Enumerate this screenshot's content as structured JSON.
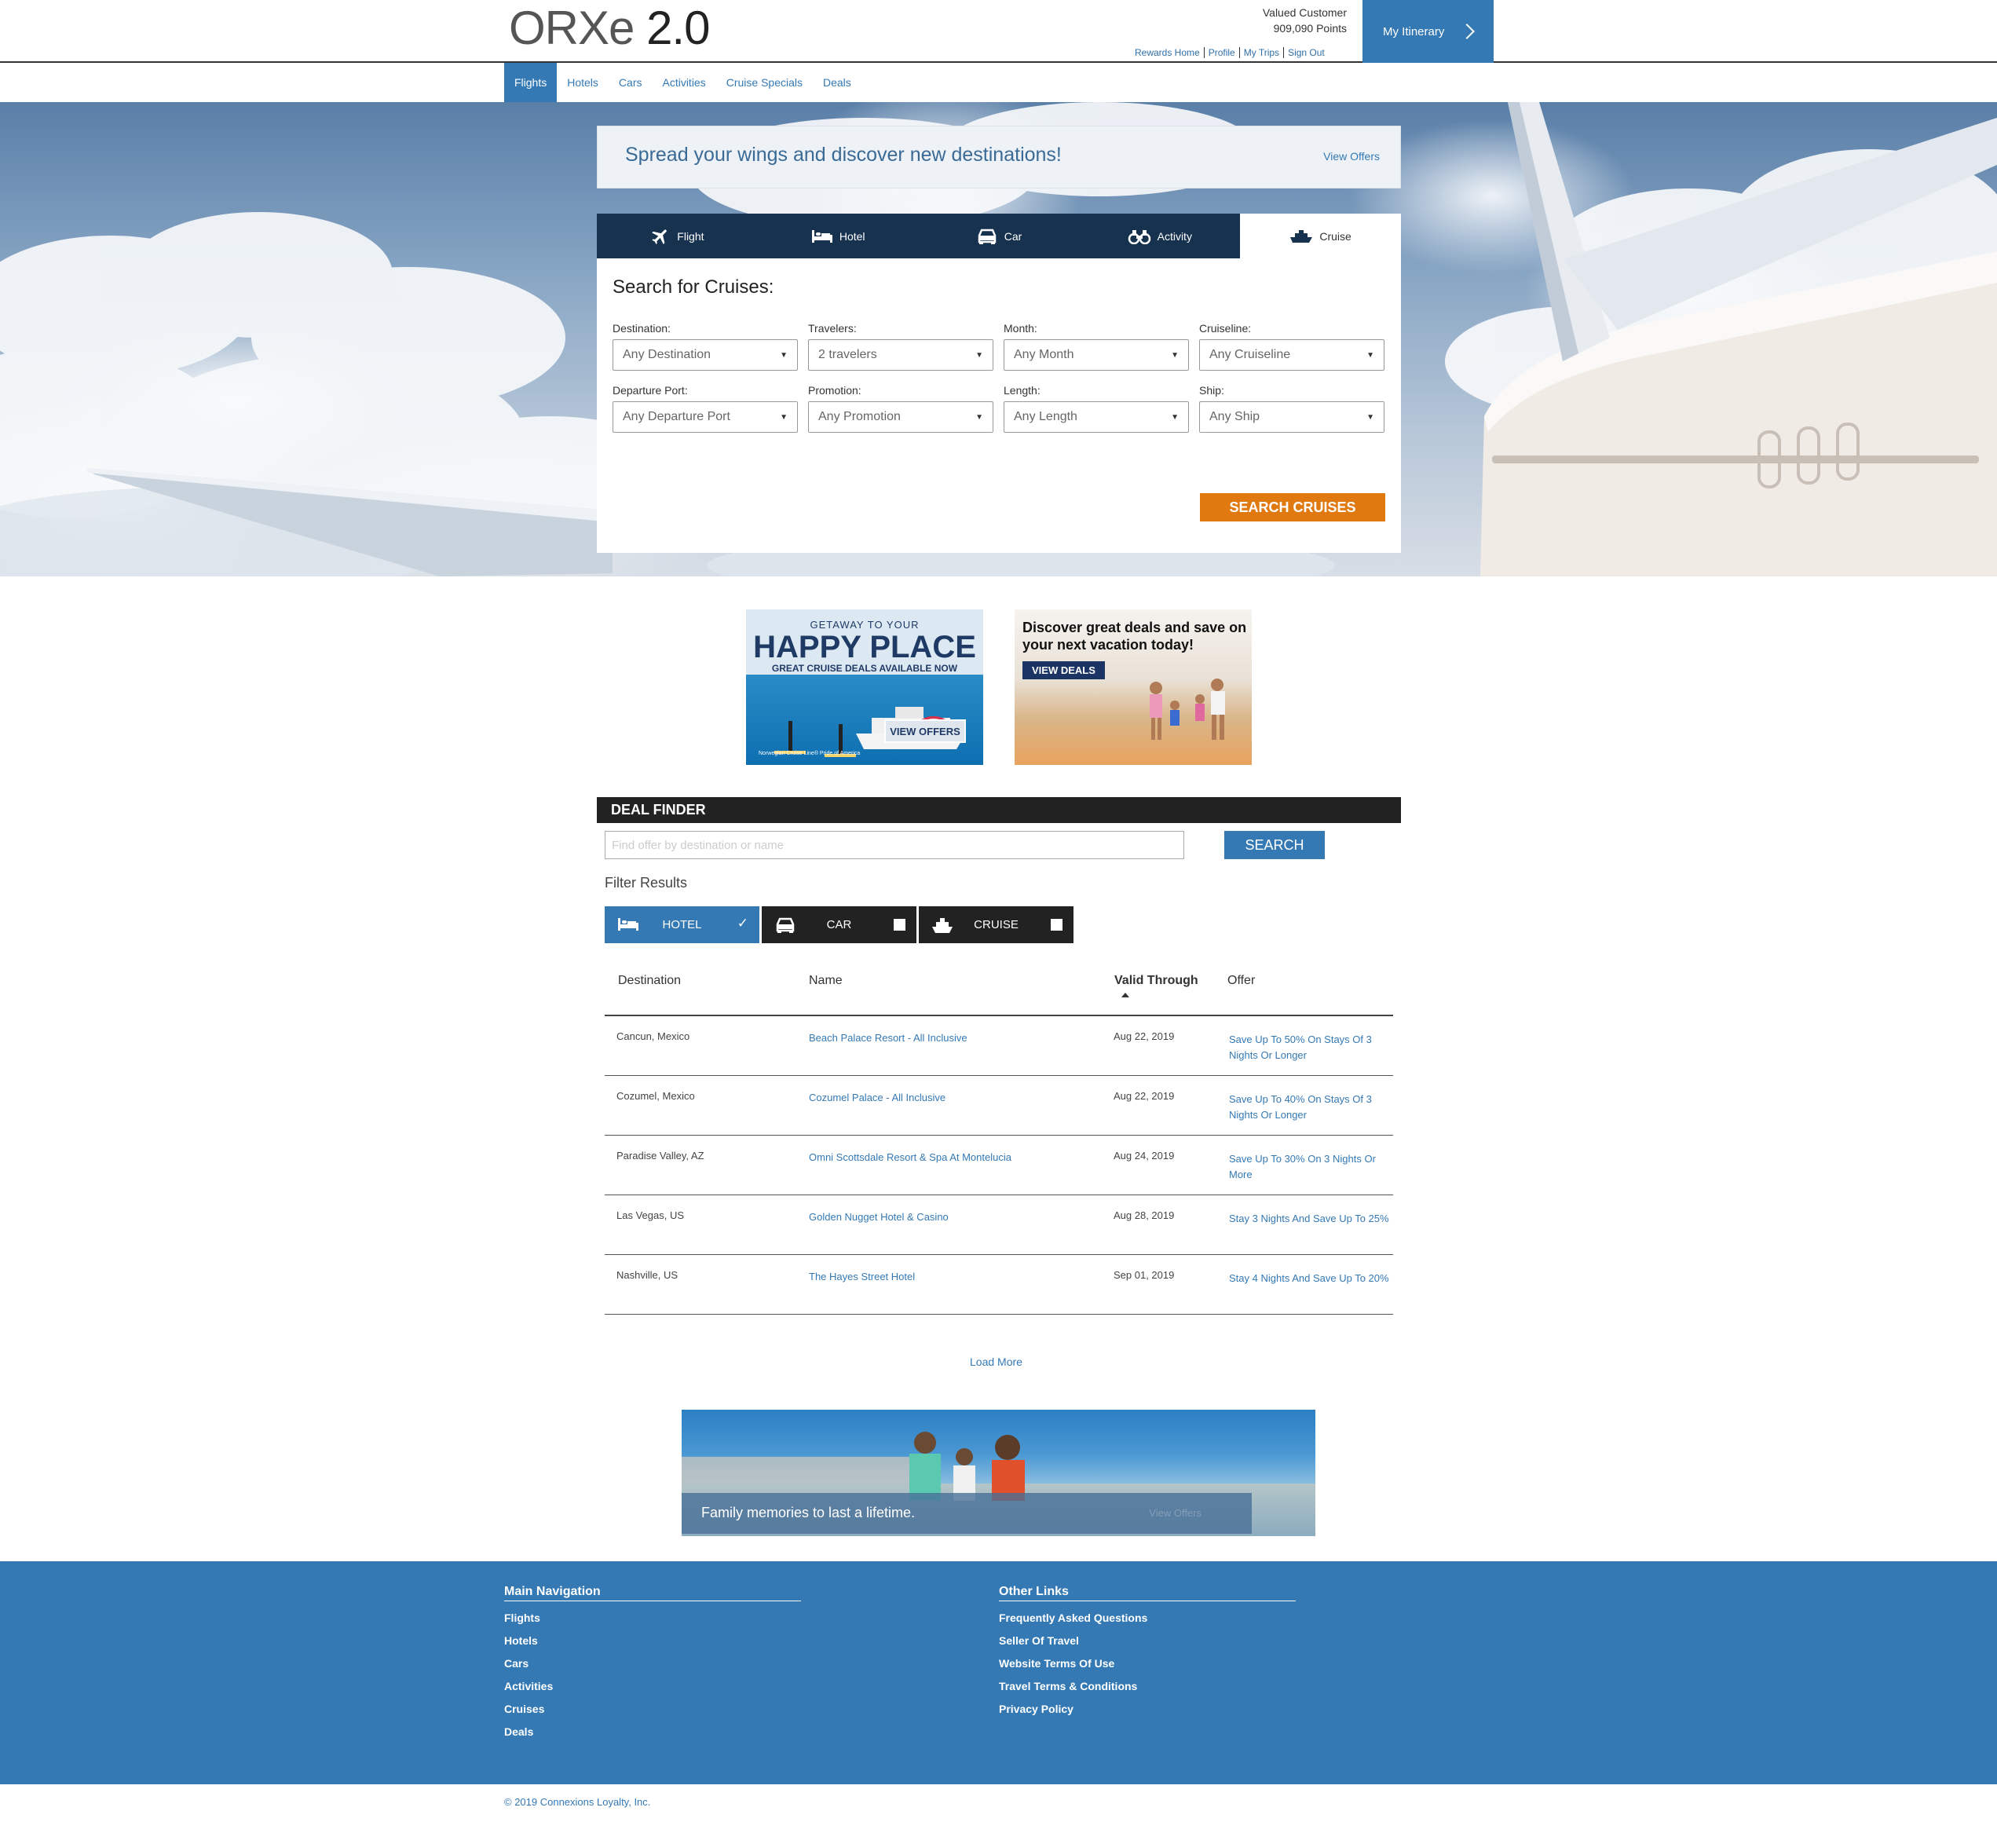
{
  "header": {
    "logo_main": "ORXe",
    "logo_version": "2.0",
    "user_name": "Valued Customer",
    "points": "909,090 Points",
    "links": [
      "Rewards Home",
      "Profile",
      "My Trips",
      "Sign Out"
    ],
    "itinerary_label": "My Itinerary"
  },
  "nav": {
    "items": [
      "Flights",
      "Hotels",
      "Cars",
      "Activities",
      "Cruise Specials",
      "Deals"
    ],
    "active": "Flights"
  },
  "hero": {
    "promo_message": "Spread your wings and discover new destinations!",
    "promo_link": "View Offers"
  },
  "search": {
    "tabs": [
      "Flight",
      "Hotel",
      "Car",
      "Activity",
      "Cruise"
    ],
    "active_tab": "Cruise",
    "title": "Search for Cruises:",
    "fields": [
      {
        "label": "Destination:",
        "value": "Any Destination"
      },
      {
        "label": "Travelers:",
        "value": "2 travelers"
      },
      {
        "label": "Month:",
        "value": "Any Month"
      },
      {
        "label": "Cruiseline:",
        "value": "Any Cruiseline"
      },
      {
        "label": "Departure Port:",
        "value": "Any Departure Port"
      },
      {
        "label": "Promotion:",
        "value": "Any Promotion"
      },
      {
        "label": "Length:",
        "value": "Any Length"
      },
      {
        "label": "Ship:",
        "value": "Any Ship"
      }
    ],
    "submit_label": "SEARCH CRUISES"
  },
  "ads": {
    "ad1": {
      "line1": "GETAWAY TO YOUR",
      "line2": "HAPPY PLACE",
      "line3": "GREAT CRUISE DEALS AVAILABLE NOW",
      "button": "VIEW OFFERS",
      "fine": "Norwegian Cruise Line® Pride of America"
    },
    "ad2": {
      "headline": "Discover great deals and save on your next vacation today!",
      "button": "VIEW DEALS"
    }
  },
  "deal_finder": {
    "title": "DEAL FINDER",
    "placeholder": "Find offer by destination or name",
    "search_label": "SEARCH",
    "filter_title": "Filter Results",
    "filters": [
      {
        "label": "HOTEL",
        "checked": true
      },
      {
        "label": "CAR",
        "checked": false
      },
      {
        "label": "CRUISE",
        "checked": false
      }
    ],
    "columns": [
      "Destination",
      "Name",
      "Valid Through",
      "Offer"
    ],
    "rows": [
      {
        "destination": "Cancun, Mexico",
        "name": "Beach Palace Resort - All Inclusive",
        "valid": "Aug 22, 2019",
        "offer": "Save Up To 50% On Stays Of 3 Nights Or Longer"
      },
      {
        "destination": "Cozumel, Mexico",
        "name": "Cozumel Palace - All Inclusive",
        "valid": "Aug 22, 2019",
        "offer": "Save Up To 40% On Stays Of 3 Nights Or Longer"
      },
      {
        "destination": "Paradise Valley, AZ",
        "name": "Omni Scottsdale Resort & Spa At Montelucia",
        "valid": "Aug 24, 2019",
        "offer": "Save Up To 30% On 3 Nights Or More"
      },
      {
        "destination": "Las Vegas, US",
        "name": "Golden Nugget Hotel & Casino",
        "valid": "Aug 28, 2019",
        "offer": "Stay 3 Nights And Save Up To 25%"
      },
      {
        "destination": "Nashville, US",
        "name": "The Hayes Street Hotel",
        "valid": "Sep 01, 2019",
        "offer": "Stay 4 Nights And Save Up To 20%"
      }
    ],
    "load_more": "Load More"
  },
  "family_banner": {
    "caption": "Family memories to last a lifetime.",
    "link": "View Offers"
  },
  "footer": {
    "main_nav_title": "Main Navigation",
    "main_nav": [
      "Flights",
      "Hotels",
      "Cars",
      "Activities",
      "Cruises",
      "Deals"
    ],
    "other_title": "Other Links",
    "other_links": [
      "Frequently Asked Questions",
      "Seller Of Travel",
      "Website Terms Of Use",
      "Travel Terms & Conditions",
      "Privacy Policy"
    ],
    "copyright": "© 2019 Connexions Loyalty, Inc."
  },
  "colors": {
    "brand_blue": "#3479b4",
    "tab_navy": "#16324f",
    "search_orange": "#e07a10",
    "dark_header": "#222222"
  }
}
